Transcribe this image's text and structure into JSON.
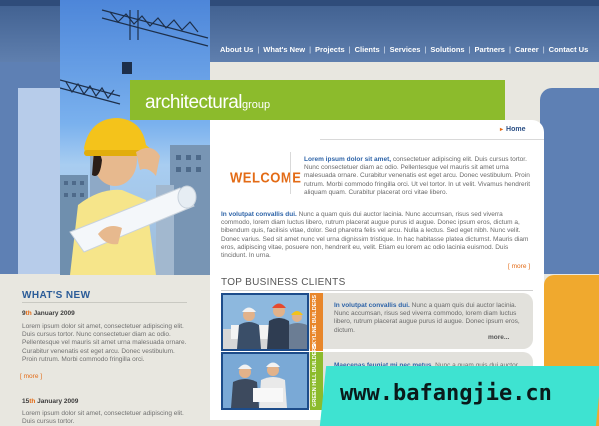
{
  "nav": {
    "items": [
      "About Us",
      "What's New",
      "Projects",
      "Clients",
      "Services",
      "Solutions",
      "Partners",
      "Career",
      "Contact Us"
    ],
    "separator": "|"
  },
  "logo": {
    "main": "architectural",
    "sub": "group"
  },
  "breadcrumb": {
    "arrow": "▸",
    "home": "Home"
  },
  "welcome": {
    "title": "WELCOME",
    "lead": "Lorem ipsum dolor sit amet,",
    "text": " consectetuer adipiscing elit. Duis cursus tortor. Nunc consectetuer diam ac odio. Pellentesque vel mauris sit amet urna malesuada ornare. Curabitur venenatis est eget arcu. Donec vestibulum. Proin rutrum. Morbi commodo fringilla orci. Ut vel tortor. In ut velit. Vivamus hendrerit aliquam quam. Curabitur placerat orci vitae libero."
  },
  "intro": {
    "lead": "In volutpat convallis dui.",
    "text": " Nunc a quam quis dui auctor lacinia. Nunc accumsan, risus sed viverra commodo, lorem diam luctus libero, rutrum placerat augue purus id augue. Donec ipsum eros, dictum a, bibendum quis, facilisis vitae, dolor. Sed pharetra felis vel arcu. Nulla a lectus. Sed eget nibh. Nunc velit. Donec varius. Sed sit amet nunc vel urna dignissim tristique. In hac habitasse platea dictumst. Mauris diam eros, adipiscing vitae, posuere non, hendrerit eu, velit. Etiam eu lorem ac odio lacinia euismod. Duis tincidunt. In urna.",
    "more": "more"
  },
  "clients": {
    "title": "TOP BUSINESS CLIENTS",
    "items": [
      {
        "tab": "SKYLINE BUILDERS",
        "tab_color": "#e8862a",
        "lead": "In volutpat convallis dui.",
        "text": " Nunc a quam quis dui auctor lacinia. Nunc accumsan, risus sed viverra commodo, lorem diam luctus libero, rutrum placerat augue purus id augue. Donec ipsum eros, dictum.",
        "more": "more..."
      },
      {
        "tab": "GREEN HILL BUILDERS",
        "tab_color": "#8cbb2c",
        "lead": "Maecenas feugiat mi nec metus.",
        "text": " Nunc a quam quis dui auctor lacinia.",
        "more": ""
      }
    ]
  },
  "news": {
    "title": "WHAT'S NEW",
    "items": [
      {
        "day": "9",
        "ord": "th",
        "date": " January 2009",
        "text": "Lorem ipsum dolor sit amet, consectetuer adipiscing elit. Duis cursus tortor. Nunc consectetuer diam ac odio. Pellentesque vel mauris sit amet urna malesuada ornare. Curabitur venenatis est eget arcu. Donec vestibulum. Proin rutrum. Morbi commodo fringilla orci.",
        "more": "more"
      },
      {
        "day": "15",
        "ord": "th",
        "date": " January 2009",
        "text": "Lorem ipsum dolor sit amet, consectetuer adipiscing elit. Duis cursus tortor.",
        "more": ""
      }
    ]
  },
  "watermark": "www.bafangjie.cn",
  "colors": {
    "accent": "#e36b16",
    "brand_blue": "#3f5f8f",
    "brand_green": "#8cbb2c"
  }
}
